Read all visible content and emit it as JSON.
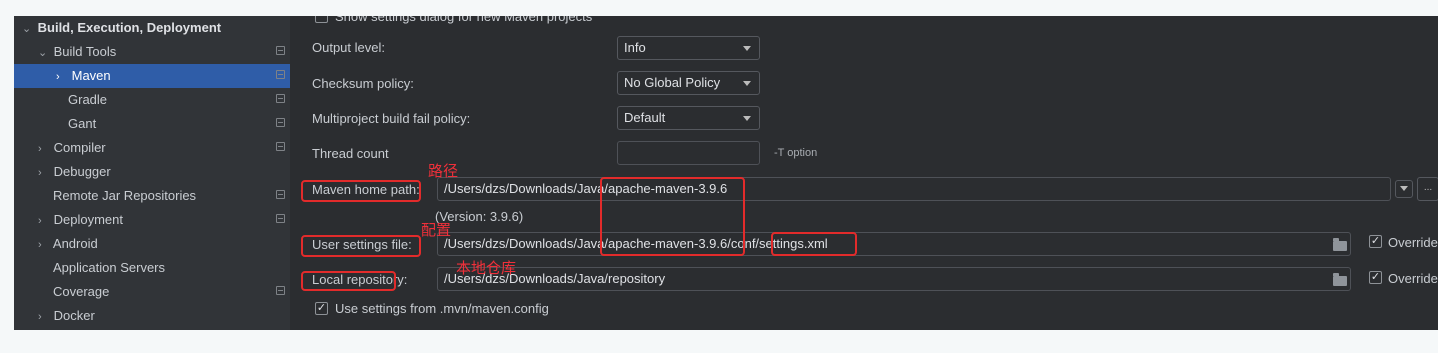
{
  "sidebar": {
    "items": [
      {
        "label": "Build, Execution, Deployment",
        "chevron": "⌄"
      },
      {
        "label": "Build Tools",
        "chevron": "⌄"
      },
      {
        "label": "Maven",
        "chevron": "›"
      },
      {
        "label": "Gradle",
        "chevron": ""
      },
      {
        "label": "Gant",
        "chevron": ""
      },
      {
        "label": "Compiler",
        "chevron": "›"
      },
      {
        "label": "Debugger",
        "chevron": "›"
      },
      {
        "label": "Remote Jar Repositories",
        "chevron": ""
      },
      {
        "label": "Deployment",
        "chevron": "›"
      },
      {
        "label": "Android",
        "chevron": "›"
      },
      {
        "label": "Application Servers",
        "chevron": ""
      },
      {
        "label": "Coverage",
        "chevron": ""
      },
      {
        "label": "Docker",
        "chevron": "›"
      }
    ]
  },
  "main": {
    "show_settings_label": "Show settings dialog for new Maven projects",
    "output_level_label": "Output level:",
    "output_level_value": "Info",
    "checksum_label": "Checksum policy:",
    "checksum_value": "No Global Policy",
    "multiproject_label": "Multiproject build fail policy:",
    "multiproject_value": "Default",
    "thread_count_label": "Thread count",
    "thread_count_value": "",
    "t_option": "-T option",
    "maven_home_label": "Maven home path:",
    "maven_home_value": "/Users/dzs/Downloads/Java/apache-maven-3.9.6",
    "version_text": "(Version: 3.9.6)",
    "user_settings_label": "User settings file:",
    "user_settings_value": "/Users/dzs/Downloads/Java/apache-maven-3.9.6/conf/settings.xml",
    "override_label": "Override",
    "local_repo_label": "Local repository:",
    "local_repo_value": "/Users/dzs/Downloads/Java/repository",
    "use_mvn_config_label": "Use settings from .mvn/maven.config",
    "browse_button": "..."
  },
  "annotations": {
    "path_note": "路径",
    "config_note": "配置",
    "local_repo_note": "本地仓库"
  },
  "colors": {
    "background": "#2b2d30",
    "selection": "#2f5da8",
    "annotation_red": "#e22b2b"
  }
}
